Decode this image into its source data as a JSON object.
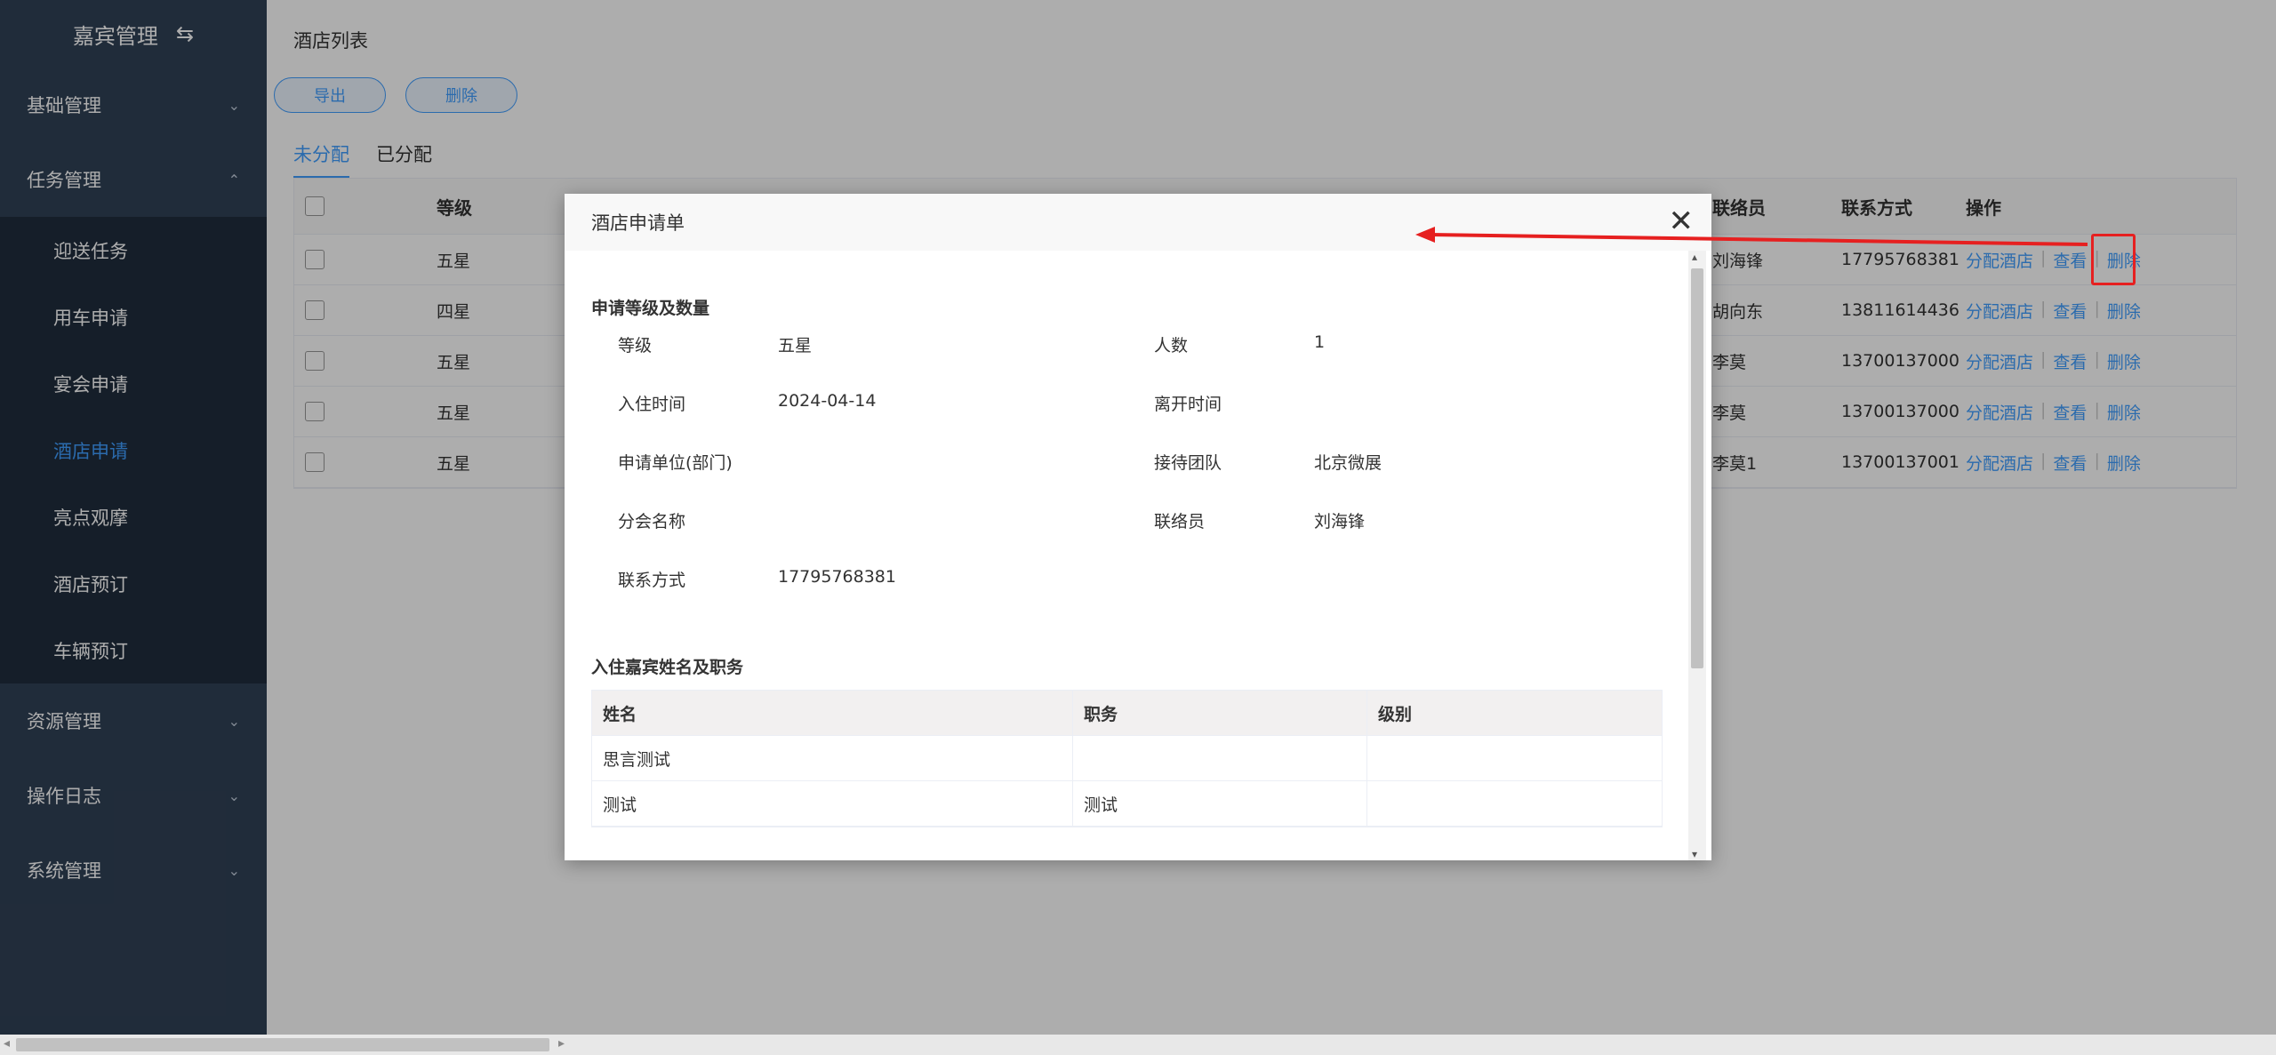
{
  "sidebar": {
    "title": "嘉宾管理",
    "menu": {
      "basic": "基础管理",
      "task": "任务管理",
      "resource": "资源管理",
      "oplog": "操作日志",
      "system": "系统管理"
    },
    "subitems": [
      "迎送任务",
      "用车申请",
      "宴会申请",
      "酒店申请",
      "亮点观摩",
      "酒店预订",
      "车辆预订"
    ],
    "active": "酒店申请"
  },
  "main": {
    "title": "酒店列表",
    "export_label": "导出",
    "delete_label": "删除",
    "tabs": [
      "未分配",
      "已分配"
    ],
    "table": {
      "headers": {
        "level": "等级",
        "contact": "联络员",
        "phone": "联系方式",
        "ops": "操作"
      },
      "rows": [
        {
          "level": "五星",
          "contact": "刘海锋",
          "phone": "17795768381"
        },
        {
          "level": "四星",
          "contact": "胡向东",
          "phone": "13811614436"
        },
        {
          "level": "五星",
          "contact": "李莫",
          "phone": "13700137000"
        },
        {
          "level": "五星",
          "contact": "李莫",
          "phone": "13700137000"
        },
        {
          "level": "五星",
          "contact": "李莫1",
          "phone": "13700137001"
        }
      ],
      "ops": {
        "assign": "分配酒店",
        "view": "查看",
        "delete": "删除"
      }
    }
  },
  "dialog": {
    "title": "酒店申请单",
    "section1": "申请等级及数量",
    "fields": {
      "level_label": "等级",
      "level_value": "五星",
      "count_label": "人数",
      "count_value": "1",
      "checkin_label": "入住时间",
      "checkin_value": "2024-04-14",
      "checkout_label": "离开时间",
      "checkout_value": "",
      "unit_label": "申请单位(部门)",
      "unit_value": "",
      "team_label": "接待团队",
      "team_value": "北京微展",
      "branch_label": "分会名称",
      "branch_value": "",
      "liaison_label": "联络员",
      "liaison_value": "刘海锋",
      "phone_label": "联系方式",
      "phone_value": "17795768381"
    },
    "section2": "入住嘉宾姓名及职务",
    "guest_table": {
      "headers": {
        "name": "姓名",
        "duty": "职务",
        "level": "级别"
      },
      "rows": [
        {
          "name": "思言测试",
          "duty": "",
          "level": ""
        },
        {
          "name": "测试",
          "duty": "测试",
          "level": ""
        }
      ]
    }
  },
  "colors": {
    "accent": "#409eff",
    "sidebar": "#304156",
    "annotation": "#e62020"
  }
}
